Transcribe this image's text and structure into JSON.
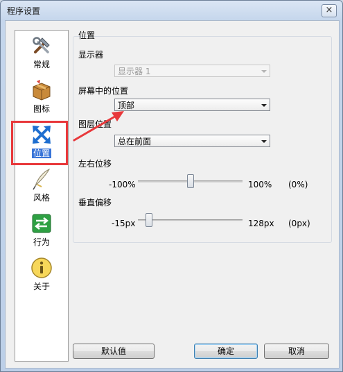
{
  "window": {
    "title": "程序设置",
    "close_glyph": "×"
  },
  "sidebar": {
    "items": [
      {
        "label": "常规",
        "icon": "tools-icon"
      },
      {
        "label": "图标",
        "icon": "package-icon"
      },
      {
        "label": "位置",
        "icon": "move-arrows-icon",
        "selected": true
      },
      {
        "label": "风格",
        "icon": "quill-icon"
      },
      {
        "label": "行为",
        "icon": "swap-arrows-icon"
      },
      {
        "label": "关于",
        "icon": "info-icon"
      }
    ]
  },
  "panel": {
    "group_title": "位置",
    "monitor": {
      "label": "显示器",
      "value": "显示器 1"
    },
    "screen_position": {
      "label": "屏幕中的位置",
      "value": "顶部"
    },
    "layer_position": {
      "label": "图层位置",
      "value": "总在前面"
    },
    "h_offset": {
      "label": "左右位移",
      "min": "-100%",
      "max": "100%",
      "value_text": "(0%)",
      "value": 0,
      "min_value": -100,
      "max_value": 100
    },
    "v_offset": {
      "label": "垂直偏移",
      "min": "-15px",
      "max": "128px",
      "value_text": "(0px)",
      "value": 0,
      "min_value": -15,
      "max_value": 128
    }
  },
  "buttons": {
    "defaults": "默认值",
    "ok": "确定",
    "cancel": "取消"
  },
  "colors": {
    "highlight_red": "#e8383b",
    "selection_blue": "#3874d8"
  }
}
